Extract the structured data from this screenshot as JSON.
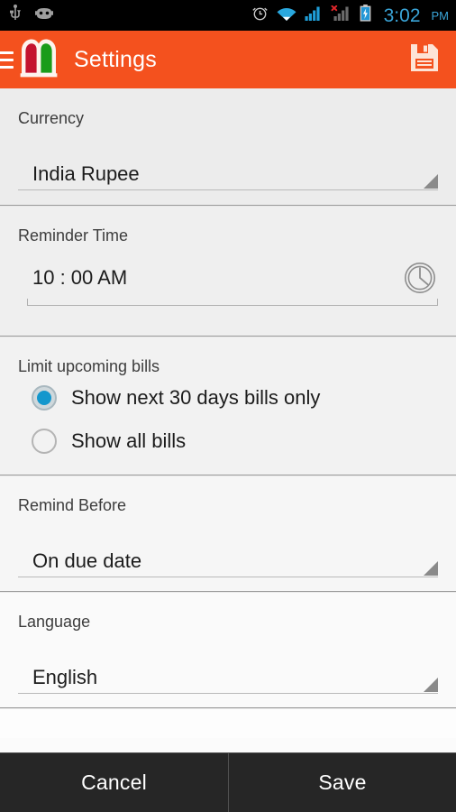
{
  "statusbar": {
    "icons_left": [
      "usb-icon",
      "android-debug-icon"
    ],
    "icons_right": [
      "alarm-icon",
      "wifi-icon",
      "signal-icon",
      "signal-no-sim-icon",
      "battery-charging-icon"
    ],
    "time": "3:02",
    "ampm": "PM",
    "time_color": "#3aa5d8",
    "background": "#000000"
  },
  "actionbar": {
    "drawer_icon": "hamburger-menu-icon",
    "logo_icon": "open-book-logo",
    "logo_colors": {
      "left_page": "#c4122f",
      "right_page": "#1a9c1a",
      "cover": "#fdf3ee"
    },
    "title": "Settings",
    "save_icon": "floppy-disk-save-icon",
    "background": "#f4511e",
    "text_color": "#ffffff"
  },
  "sections": {
    "currency": {
      "label": "Currency",
      "value": "India Rupee",
      "control": "spinner"
    },
    "reminder_time": {
      "label": "Reminder Time",
      "value": "10 : 00 AM",
      "control": "time-picker",
      "icon": "clock-icon"
    },
    "limit_upcoming_bills": {
      "label": "Limit upcoming bills",
      "options": [
        {
          "label": "Show next 30 days bills only",
          "selected": true
        },
        {
          "label": "Show all bills",
          "selected": false
        }
      ],
      "selected_color": "#1397cd"
    },
    "remind_before": {
      "label": "Remind Before",
      "value": "On due date",
      "control": "spinner"
    },
    "language": {
      "label": "Language",
      "value": "English",
      "control": "spinner"
    }
  },
  "buttonbar": {
    "cancel_label": "Cancel",
    "save_label": "Save",
    "background": "#262626",
    "text_color": "#ffffff"
  }
}
